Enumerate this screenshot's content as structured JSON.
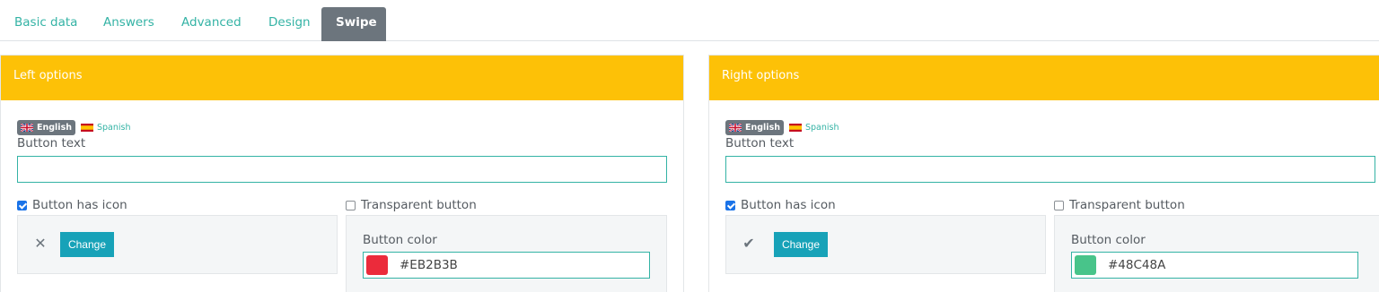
{
  "tabs": [
    {
      "label": "Basic data"
    },
    {
      "label": "Answers"
    },
    {
      "label": "Advanced"
    },
    {
      "label": "Design"
    },
    {
      "label": "Swipe"
    }
  ],
  "left": {
    "header": "Left options",
    "lang_english": "English",
    "lang_spanish": "Spanish",
    "button_text_label": "Button text",
    "button_text_value": "",
    "has_icon_label": "Button has icon",
    "has_icon_checked": true,
    "transparent_label": "Transparent button",
    "transparent_checked": false,
    "icon_name": "close-icon",
    "icon_glyph": "✕",
    "change_label": "Change",
    "button_color_label": "Button color",
    "button_color": "#EB2B3B"
  },
  "right": {
    "header": "Right options",
    "lang_english": "English",
    "lang_spanish": "Spanish",
    "button_text_label": "Button text",
    "button_text_value": "",
    "has_icon_label": "Button has icon",
    "has_icon_checked": true,
    "transparent_label": "Transparent button",
    "transparent_checked": false,
    "icon_name": "check-icon",
    "icon_glyph": "✔",
    "change_label": "Change",
    "button_color_label": "Button color",
    "button_color": "#48C48A"
  },
  "colors": {
    "accent": "#34B3A5",
    "header": "#FDC107",
    "active_tab": "#6C757D",
    "change_button": "#17A2B8"
  }
}
